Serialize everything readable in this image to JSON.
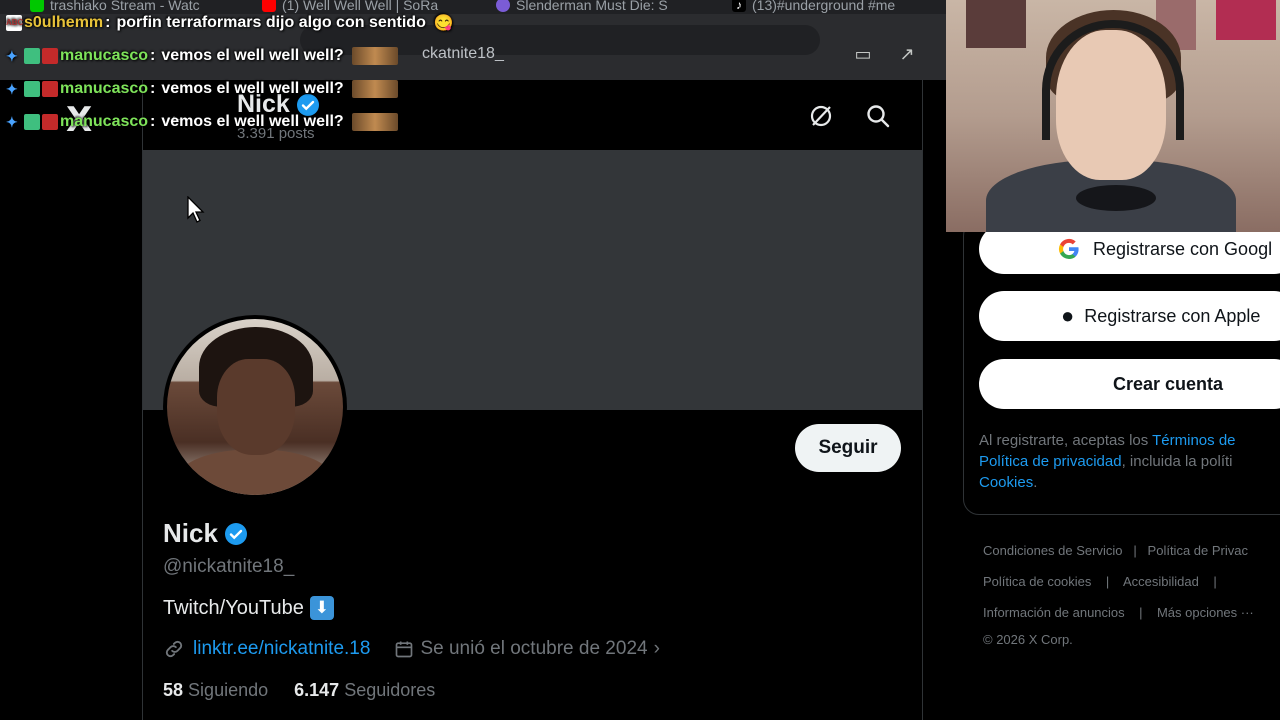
{
  "browser": {
    "tabs": [
      {
        "title": "trashiako Stream - Watc",
        "icon_color": "#00c800",
        "icon": "kick-icon"
      },
      {
        "title": "(1) Well Well Well | SoRa",
        "icon_color": "#ff0000",
        "icon": "youtube-icon"
      },
      {
        "title": "Slenderman Must Die: S",
        "icon_color": "#7b5cd6",
        "icon": "app-icon"
      },
      {
        "title": "(13)#underground #me",
        "icon_color": "#ffffff",
        "icon": "tiktok-icon"
      }
    ],
    "address_text": "ckatnite18_"
  },
  "chat": [
    {
      "user": "s0ulhemm",
      "message": "porfin terraformars dijo algo con sentido",
      "user_color": "#e8c33a",
      "emoji": "😋"
    },
    {
      "user": "manucasco",
      "message": "vemos el well well well?",
      "user_color": "#7ee35a"
    },
    {
      "user": "manucasco",
      "message": "vemos el well well well?",
      "user_color": "#7ee35a"
    },
    {
      "user": "manucasco",
      "message": "vemos el well well well?",
      "user_color": "#7ee35a"
    }
  ],
  "header": {
    "name": "Nick",
    "posts": "3.391 posts"
  },
  "profile": {
    "name": "Nick",
    "handle": "@nickatnite18_",
    "bio": "Twitch/YouTube",
    "bio_emoji": "⬇",
    "link": "linktr.ee/nickatnite.18",
    "joined": "Se unió el octubre de 2024",
    "following_count": "58",
    "following_label": "Siguiendo",
    "followers_count": "6.147",
    "followers_label": "Seguidores",
    "follow_button": "Seguir"
  },
  "sidebar": {
    "google_btn": "Registrarse con Googl",
    "apple_btn": "Registrarse con Apple",
    "create_btn": "Crear cuenta",
    "legal_prefix": "Al registrarte, aceptas los ",
    "terms_link": "Términos de",
    "privacy_link": "Política de privacidad",
    "legal_middle": ", incluida la políti",
    "cookies_link": "Cookies",
    "legal_suffix": "."
  },
  "footer": {
    "row1": [
      "Condiciones de Servicio",
      "|",
      "Política de Privac"
    ],
    "row2": [
      "Política de cookies",
      "|",
      "Accesibilidad",
      "|"
    ],
    "row3": [
      "Información de anuncios",
      "|",
      "Más opciones ···"
    ],
    "copyright": "© 2026 X Corp."
  },
  "colors": {
    "accent": "#1d9bf0",
    "verified": "#1d9bf0",
    "banner": "#333639"
  }
}
